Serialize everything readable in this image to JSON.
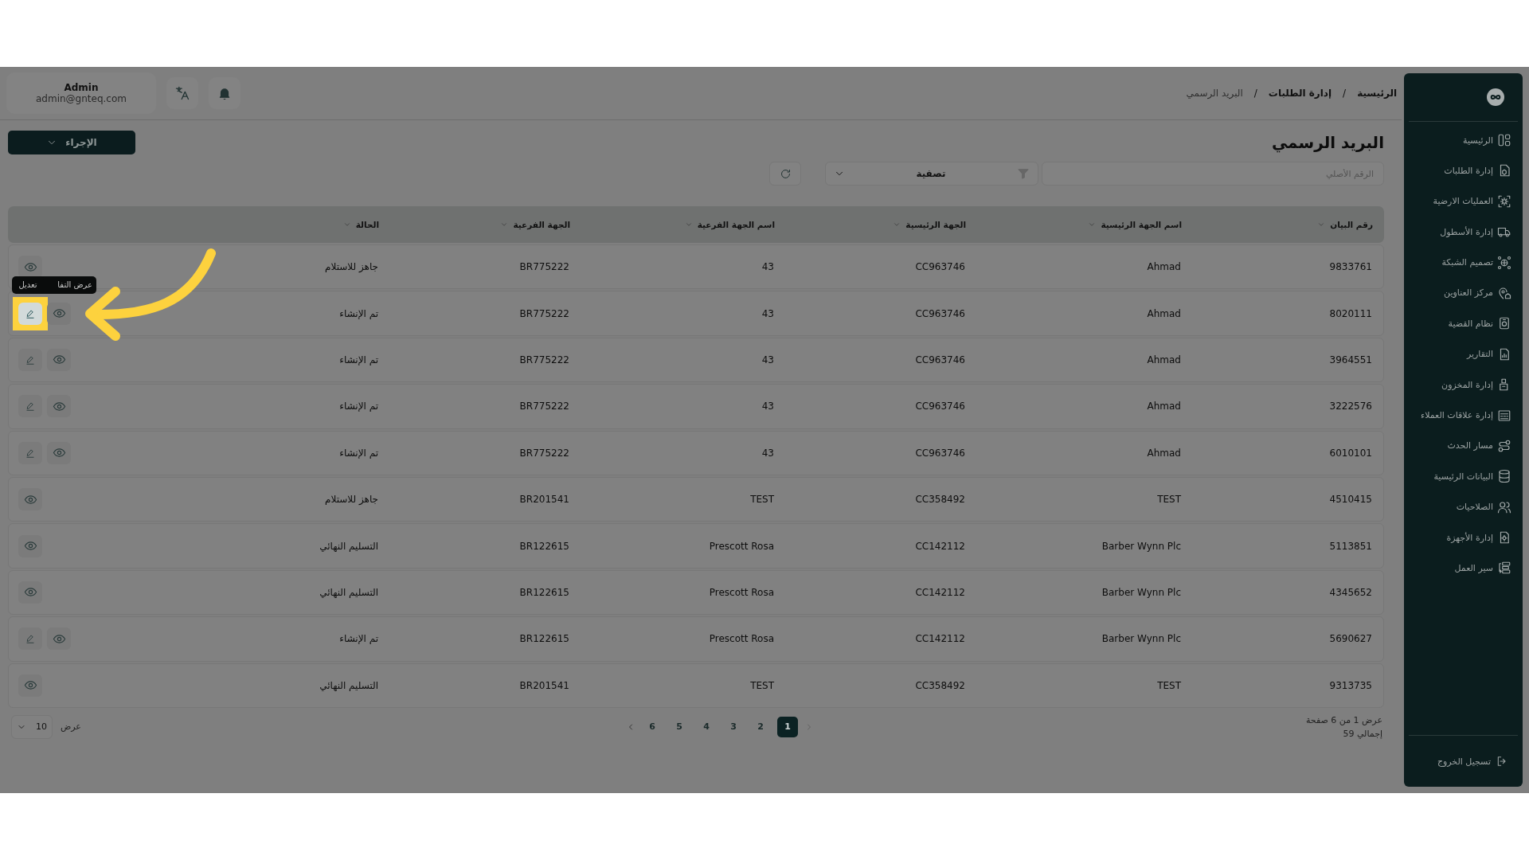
{
  "breadcrumb": {
    "separator": "/",
    "items": [
      {
        "label": "الرئيسية",
        "current": false
      },
      {
        "label": "إدارة الطلبات",
        "current": false
      },
      {
        "label": "البريد الرسمي",
        "current": true
      }
    ]
  },
  "user": {
    "name": "Admin",
    "email": "admin@gnteq.com"
  },
  "action_button": {
    "label": "الإجراء"
  },
  "page_title": "البريد الرسمي",
  "search": {
    "placeholder": "الرقم الأصلي"
  },
  "filter": {
    "label": "تصفية"
  },
  "table": {
    "columns": [
      "رقم البيان",
      "اسم الجهة الرئيسية",
      "الجهة الرئيسية",
      "اسم الجهة الفرعية",
      "الجهة الفرعية",
      "الحالة"
    ],
    "rows": [
      {
        "cells": [
          "9833761",
          "Ahmad",
          "CC963746",
          "43",
          "BR775222",
          "جاهز للاستلام"
        ],
        "editable": false
      },
      {
        "cells": [
          "8020111",
          "Ahmad",
          "CC963746",
          "43",
          "BR775222",
          "تم الإنشاء"
        ],
        "editable": true,
        "edit_highlighted": true
      },
      {
        "cells": [
          "3964551",
          "Ahmad",
          "CC963746",
          "43",
          "BR775222",
          "تم الإنشاء"
        ],
        "editable": true,
        "edit_highlighted": false
      },
      {
        "cells": [
          "3222576",
          "Ahmad",
          "CC963746",
          "43",
          "BR775222",
          "تم الإنشاء"
        ],
        "editable": true,
        "edit_highlighted": false
      },
      {
        "cells": [
          "6010101",
          "Ahmad",
          "CC963746",
          "43",
          "BR775222",
          "تم الإنشاء"
        ],
        "editable": true,
        "edit_highlighted": false
      },
      {
        "cells": [
          "4510415",
          "TEST",
          "CC358492",
          "TEST",
          "BR201541",
          "جاهز للاستلام"
        ],
        "editable": false
      },
      {
        "cells": [
          "5113851",
          "Barber Wynn Plc",
          "CC142112",
          "Prescott Rosa",
          "BR122615",
          "التسليم النهائي"
        ],
        "editable": false
      },
      {
        "cells": [
          "4345652",
          "Barber Wynn Plc",
          "CC142112",
          "Prescott Rosa",
          "BR122615",
          "التسليم النهائي"
        ],
        "editable": false
      },
      {
        "cells": [
          "5690627",
          "Barber Wynn Plc",
          "CC142112",
          "Prescott Rosa",
          "BR122615",
          "تم الإنشاء"
        ],
        "editable": true,
        "edit_highlighted": false
      },
      {
        "cells": [
          "9313735",
          "TEST",
          "CC358492",
          "TEST",
          "BR201541",
          "التسليم النهائي"
        ],
        "editable": false
      }
    ]
  },
  "tooltips": [
    {
      "kind": "view",
      "text": "عرض التفا"
    },
    {
      "kind": "edit",
      "text": "تعديل"
    }
  ],
  "pagination": {
    "info": "عرض 1 من 6 صفحة",
    "total": "إجمالي 59",
    "previous_disabled": true,
    "pages": [
      {
        "label": "1",
        "selected": true
      },
      {
        "label": "2",
        "selected": false
      },
      {
        "label": "3",
        "selected": false
      },
      {
        "label": "4",
        "selected": false
      },
      {
        "label": "5",
        "selected": false
      },
      {
        "label": "6",
        "selected": false
      }
    ],
    "page_size": "10",
    "page_size_label": "عرض"
  },
  "sidebar": {
    "items": [
      {
        "label": "الرئيسية"
      },
      {
        "label": "إدارة الطلبات"
      },
      {
        "label": "العمليات الارضية"
      },
      {
        "label": "إدارة الأسطول"
      },
      {
        "label": "تصميم الشبكة"
      },
      {
        "label": "مركز العناوين"
      },
      {
        "label": "نظام القضية"
      },
      {
        "label": "التقارير"
      },
      {
        "label": "إدارة المخزون"
      },
      {
        "label": "إدارة علاقات العملاء"
      },
      {
        "label": "مسار الحدث"
      },
      {
        "label": "البيانات الرئيسية"
      },
      {
        "label": "الصلاحيات"
      },
      {
        "label": "إدارة الأجهزة"
      },
      {
        "label": "سير العمل"
      }
    ],
    "logout": "تسجيل الخروج"
  }
}
